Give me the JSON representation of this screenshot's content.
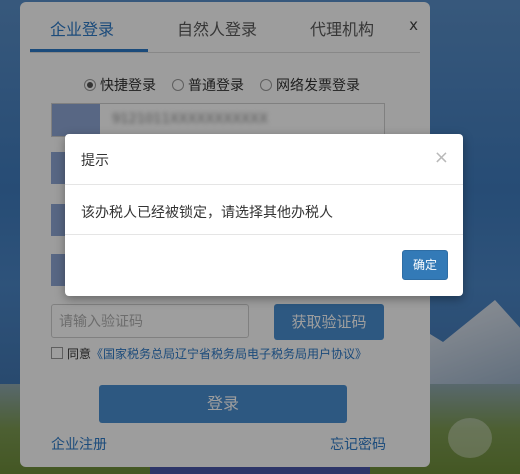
{
  "login_tabs": [
    {
      "label": "企业登录",
      "active": true
    },
    {
      "label": "自然人登录",
      "active": false
    },
    {
      "label": "代理机构",
      "active": false
    }
  ],
  "close_label": "x",
  "login_modes": [
    {
      "label": "快捷登录",
      "selected": true
    },
    {
      "label": "普通登录",
      "selected": false
    },
    {
      "label": "网络发票登录",
      "selected": false
    }
  ],
  "account_value": "9121011XXXXXXXXXXX",
  "captcha_placeholder": "请输入验证码",
  "get_code_label": "获取验证码",
  "agreement": {
    "prefix": "同意",
    "link": "《国家税务总局辽宁省税务局电子税务局用户协议》"
  },
  "login_button_label": "登录",
  "register_link": "企业注册",
  "forgot_link": "忘记密码",
  "dialog": {
    "title": "提示",
    "close_symbol": "×",
    "message": "该办税人已经被锁定，请选择其他办税人",
    "confirm_label": "确定"
  },
  "colors": {
    "accent": "#2d79c7",
    "button": "#4a8fd0",
    "dialog_button": "#337ab7"
  }
}
